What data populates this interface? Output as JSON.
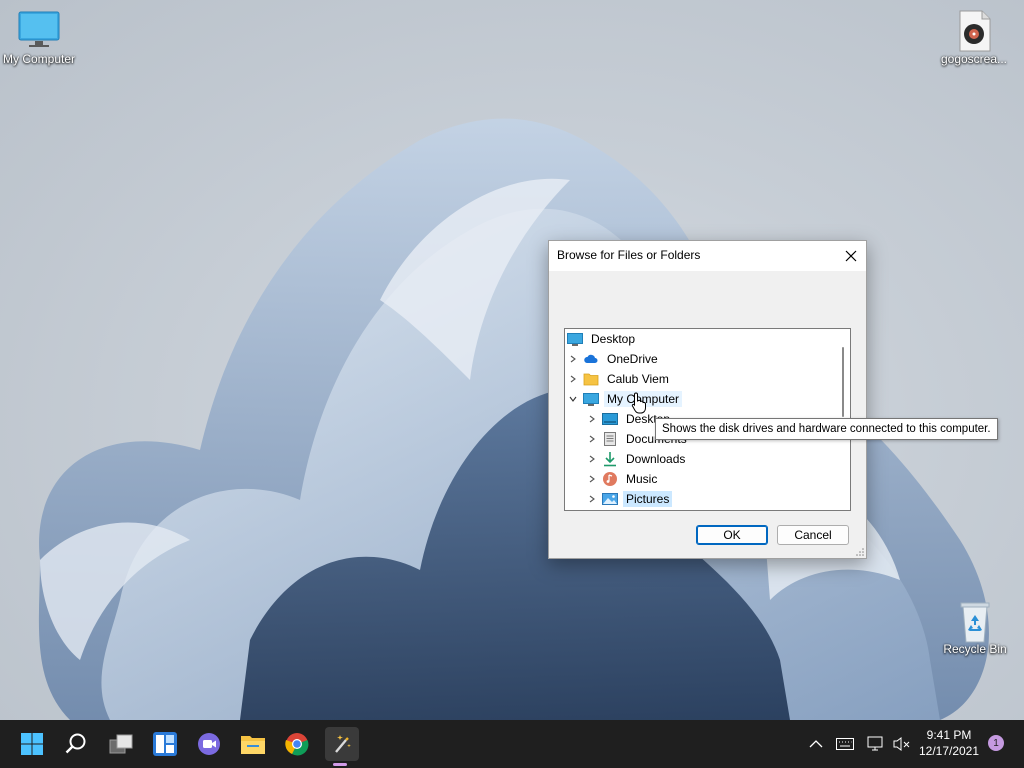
{
  "desktop": {
    "icons": [
      {
        "label": "My Computer"
      },
      {
        "label": "gogoscrea..."
      },
      {
        "label": "Recycle Bin"
      }
    ]
  },
  "dialog": {
    "title": "Browse for Files or Folders",
    "tree": [
      {
        "label": "Desktop",
        "icon": "desktop-icon",
        "level": 0,
        "expander": "none"
      },
      {
        "label": "OneDrive",
        "icon": "cloud-icon",
        "level": 1,
        "expander": "collapsed"
      },
      {
        "label": "Calub Viem",
        "icon": "folder-icon",
        "level": 1,
        "expander": "collapsed"
      },
      {
        "label": "My Computer",
        "icon": "computer-icon",
        "level": 1,
        "expander": "expanded",
        "state": "hover"
      },
      {
        "label": "Desktop",
        "icon": "desktop-icon",
        "level": 2,
        "expander": "collapsed"
      },
      {
        "label": "Documents",
        "icon": "documents-icon",
        "level": 2,
        "expander": "collapsed"
      },
      {
        "label": "Downloads",
        "icon": "downloads-icon",
        "level": 2,
        "expander": "collapsed"
      },
      {
        "label": "Music",
        "icon": "music-icon",
        "level": 2,
        "expander": "collapsed"
      },
      {
        "label": "Pictures",
        "icon": "pictures-icon",
        "level": 2,
        "expander": "collapsed",
        "state": "selected"
      }
    ],
    "ok_label": "OK",
    "cancel_label": "Cancel"
  },
  "tooltip": {
    "text": "Shows the disk drives and hardware connected to this computer."
  },
  "taskbar": {
    "icons": [
      "start-icon",
      "search-icon",
      "task-view-icon",
      "widgets-icon",
      "chat-icon",
      "file-explorer-icon",
      "chrome-icon",
      "app-wand-icon"
    ],
    "clock": {
      "time": "9:41 PM",
      "date": "12/17/2021"
    },
    "notification_count": "1"
  },
  "colors": {
    "accent": "#0067c0",
    "selection": "#cce8ff",
    "taskbar": "#1f1f1f"
  }
}
